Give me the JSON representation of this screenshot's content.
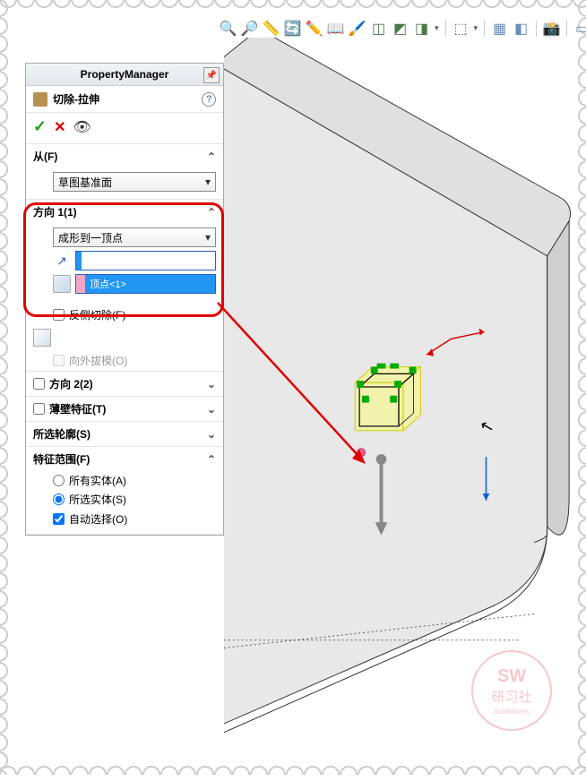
{
  "panel": {
    "title": "PropertyManager",
    "feature_name": "切除-拉伸",
    "help": "?"
  },
  "from": {
    "title": "从(F)",
    "combo": "草图基准面"
  },
  "dir1": {
    "title": "方向 1(1)",
    "combo": "成形到一顶点",
    "vertex": "顶点<1>",
    "reverse_cut": "反侧切除(F)",
    "draft_out": "向外拔模(O)"
  },
  "dir2": {
    "title": "方向 2(2)"
  },
  "thin": {
    "title": "薄壁特征(T)"
  },
  "contour": {
    "title": "所选轮廓(S)"
  },
  "scope": {
    "title": "特征范围(F)",
    "all": "所有实体(A)",
    "selected": "所选实体(S)",
    "auto": "自动选择(O)"
  },
  "watermark": {
    "sw": "SW",
    "cn": "研习社",
    "sm": "SolidWorks"
  }
}
